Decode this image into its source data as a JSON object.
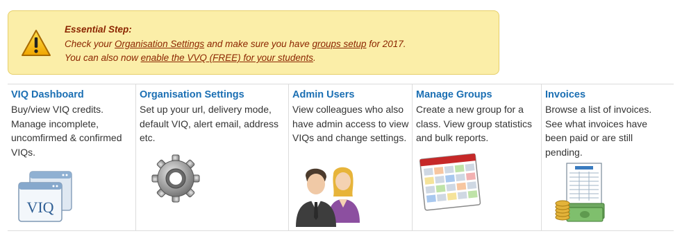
{
  "alert": {
    "title": "Essential Step:",
    "line1_prefix": "Check your ",
    "line1_link1": "Organisation Settings",
    "line1_middle": " and make sure you have ",
    "line1_link2": "groups setup",
    "line1_suffix": " for 2017.",
    "line2_prefix": "You can also now ",
    "line2_link": "enable the VVQ (FREE) for your students",
    "line2_suffix": "."
  },
  "columns": [
    {
      "title": "VIQ Dashboard",
      "description": "Buy/view VIQ credits. Manage incomplete, uncomfirmed & confirmed VIQs.",
      "icon_label": "VIQ"
    },
    {
      "title": "Organisation Settings",
      "description": "Set up your url, delivery mode, default VIQ, alert email, address etc."
    },
    {
      "title": "Admin Users",
      "description": "View colleagues who also have admin access to view VIQs and change settings."
    },
    {
      "title": "Manage Groups",
      "description": "Create a new group for a class. View group statistics and bulk reports."
    },
    {
      "title": "Invoices",
      "description": "Browse a list of invoices. See what invoices have been paid or are still pending."
    }
  ],
  "colors": {
    "accent": "#1b6fb3",
    "alert_bg": "#fbeea8",
    "alert_text": "#8b2500"
  }
}
